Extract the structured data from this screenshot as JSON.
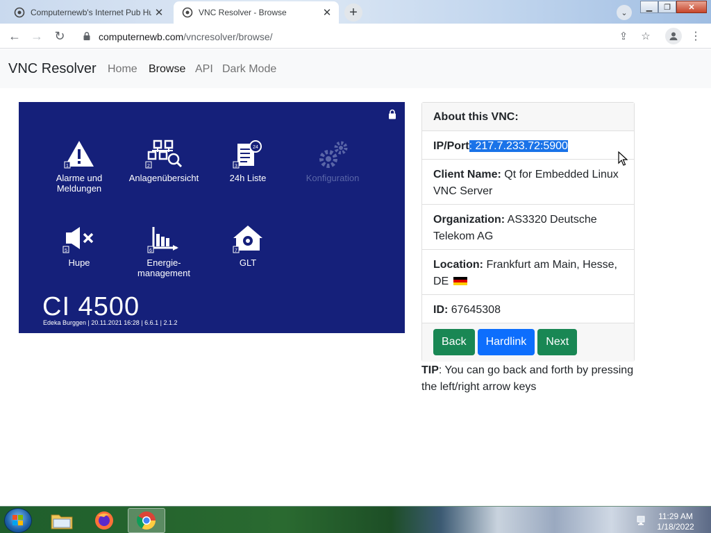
{
  "browser": {
    "tabs": [
      {
        "title": "Computernewb's Internet Pub Hu",
        "active": false
      },
      {
        "title": "VNC Resolver - Browse",
        "active": true
      }
    ],
    "new_tab_icon": "plus-icon",
    "url_host": "computernewb.com",
    "url_path": "/vncresolver/browse/"
  },
  "site": {
    "brand": "VNC Resolver",
    "nav": [
      "Home",
      "Browse",
      "API",
      "Dark Mode"
    ],
    "active_nav": "Browse"
  },
  "screenshot": {
    "tiles": [
      {
        "label": "Alarme und Meldungen",
        "num": "1",
        "icon": "warning-icon"
      },
      {
        "label": "Anlagenübersicht",
        "num": "2",
        "icon": "plant-overview-icon"
      },
      {
        "label": "24h Liste",
        "num": "3",
        "icon": "list-24h-icon"
      },
      {
        "label": "Konfiguration",
        "icon": "gears-icon",
        "disabled": true
      },
      {
        "label": "Hupe",
        "num": "5",
        "icon": "horn-mute-icon"
      },
      {
        "label": "Energie-management",
        "line1": "Energie-",
        "line2": "management",
        "num": "6",
        "icon": "energy-chart-icon"
      },
      {
        "label": "GLT",
        "num": "7",
        "icon": "building-gear-icon"
      }
    ],
    "model": "CI 4500",
    "footer": "Edeka Burggen | 20.11.2021 16:28 | 6.6.1 | 2.1.2"
  },
  "info": {
    "header": "About this VNC:",
    "ip_label": "IP/Port",
    "ip_value": "217.7.233.72:5900",
    "client_label": "Client Name:",
    "client_value": "Qt for Embedded Linux VNC Server",
    "org_label": "Organization:",
    "org_value": "AS3320 Deutsche Telekom AG",
    "loc_label": "Location:",
    "loc_value": "Frankfurt am Main, Hesse, DE",
    "id_label": "ID:",
    "id_value": "67645308",
    "buttons": {
      "back": "Back",
      "hardlink": "Hardlink",
      "next": "Next"
    }
  },
  "tip": {
    "label": "TIP",
    "text": ": You can go back and forth by pressing the left/right arrow keys"
  },
  "taskbar": {
    "time": "11:29 AM",
    "date": "1/18/2022"
  }
}
